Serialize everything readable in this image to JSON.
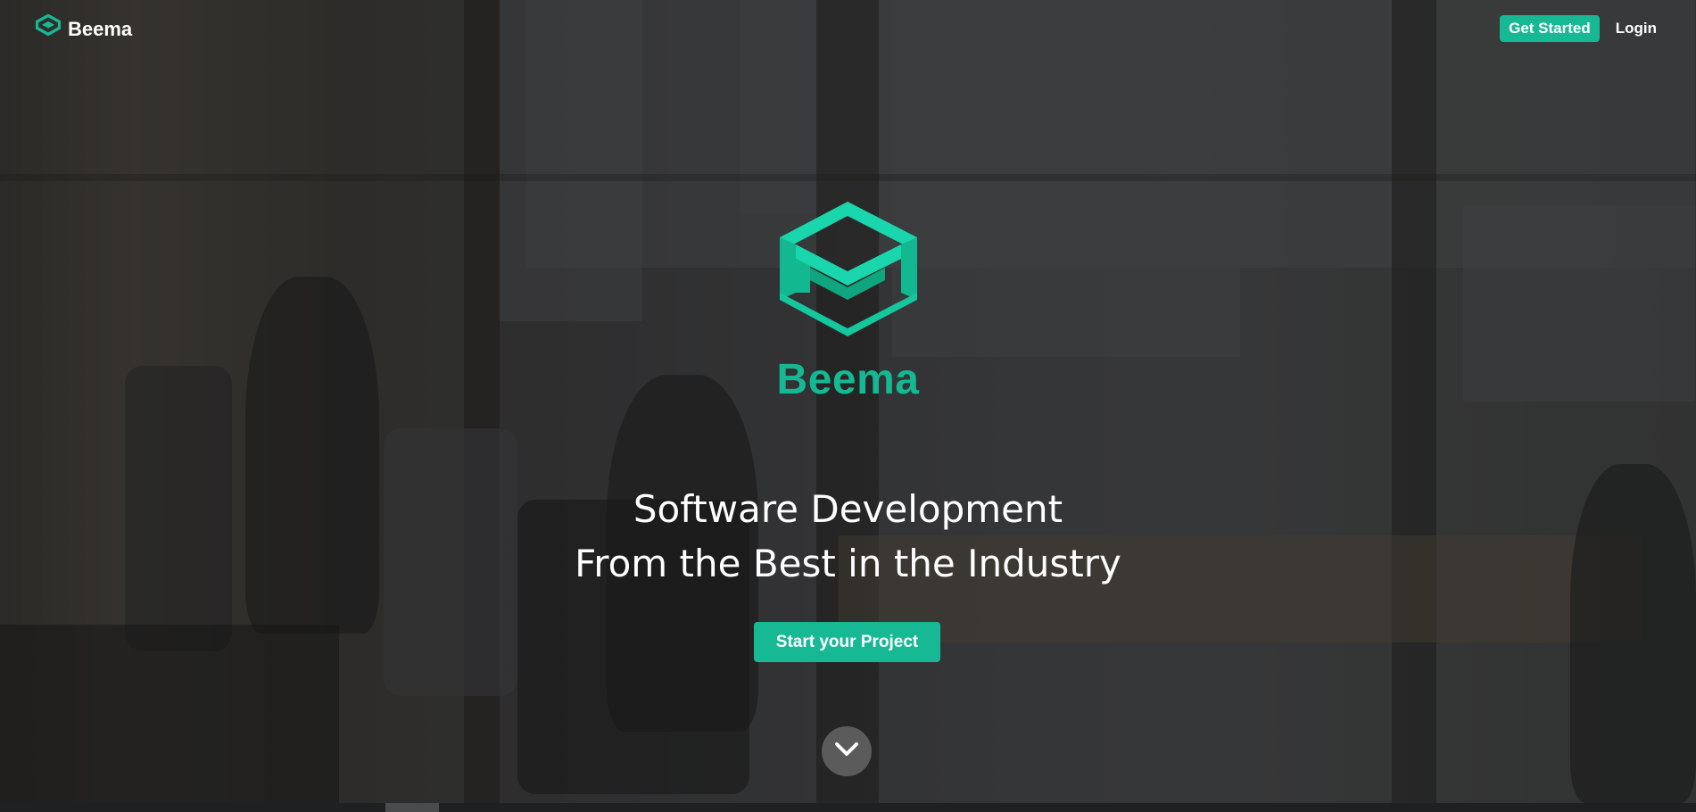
{
  "nav": {
    "brand": "Beema",
    "get_started_label": "Get Started",
    "login_label": "Login"
  },
  "hero": {
    "brand_name": "Beema",
    "headline_line1": "Software Development",
    "headline_line2": "From the Best in the Industry",
    "cta_label": "Start your Project",
    "scroll_icon": "chevron-down-icon"
  },
  "colors": {
    "accent": "#17b894",
    "brand_text": "#14b994",
    "text": "#ffffff"
  }
}
